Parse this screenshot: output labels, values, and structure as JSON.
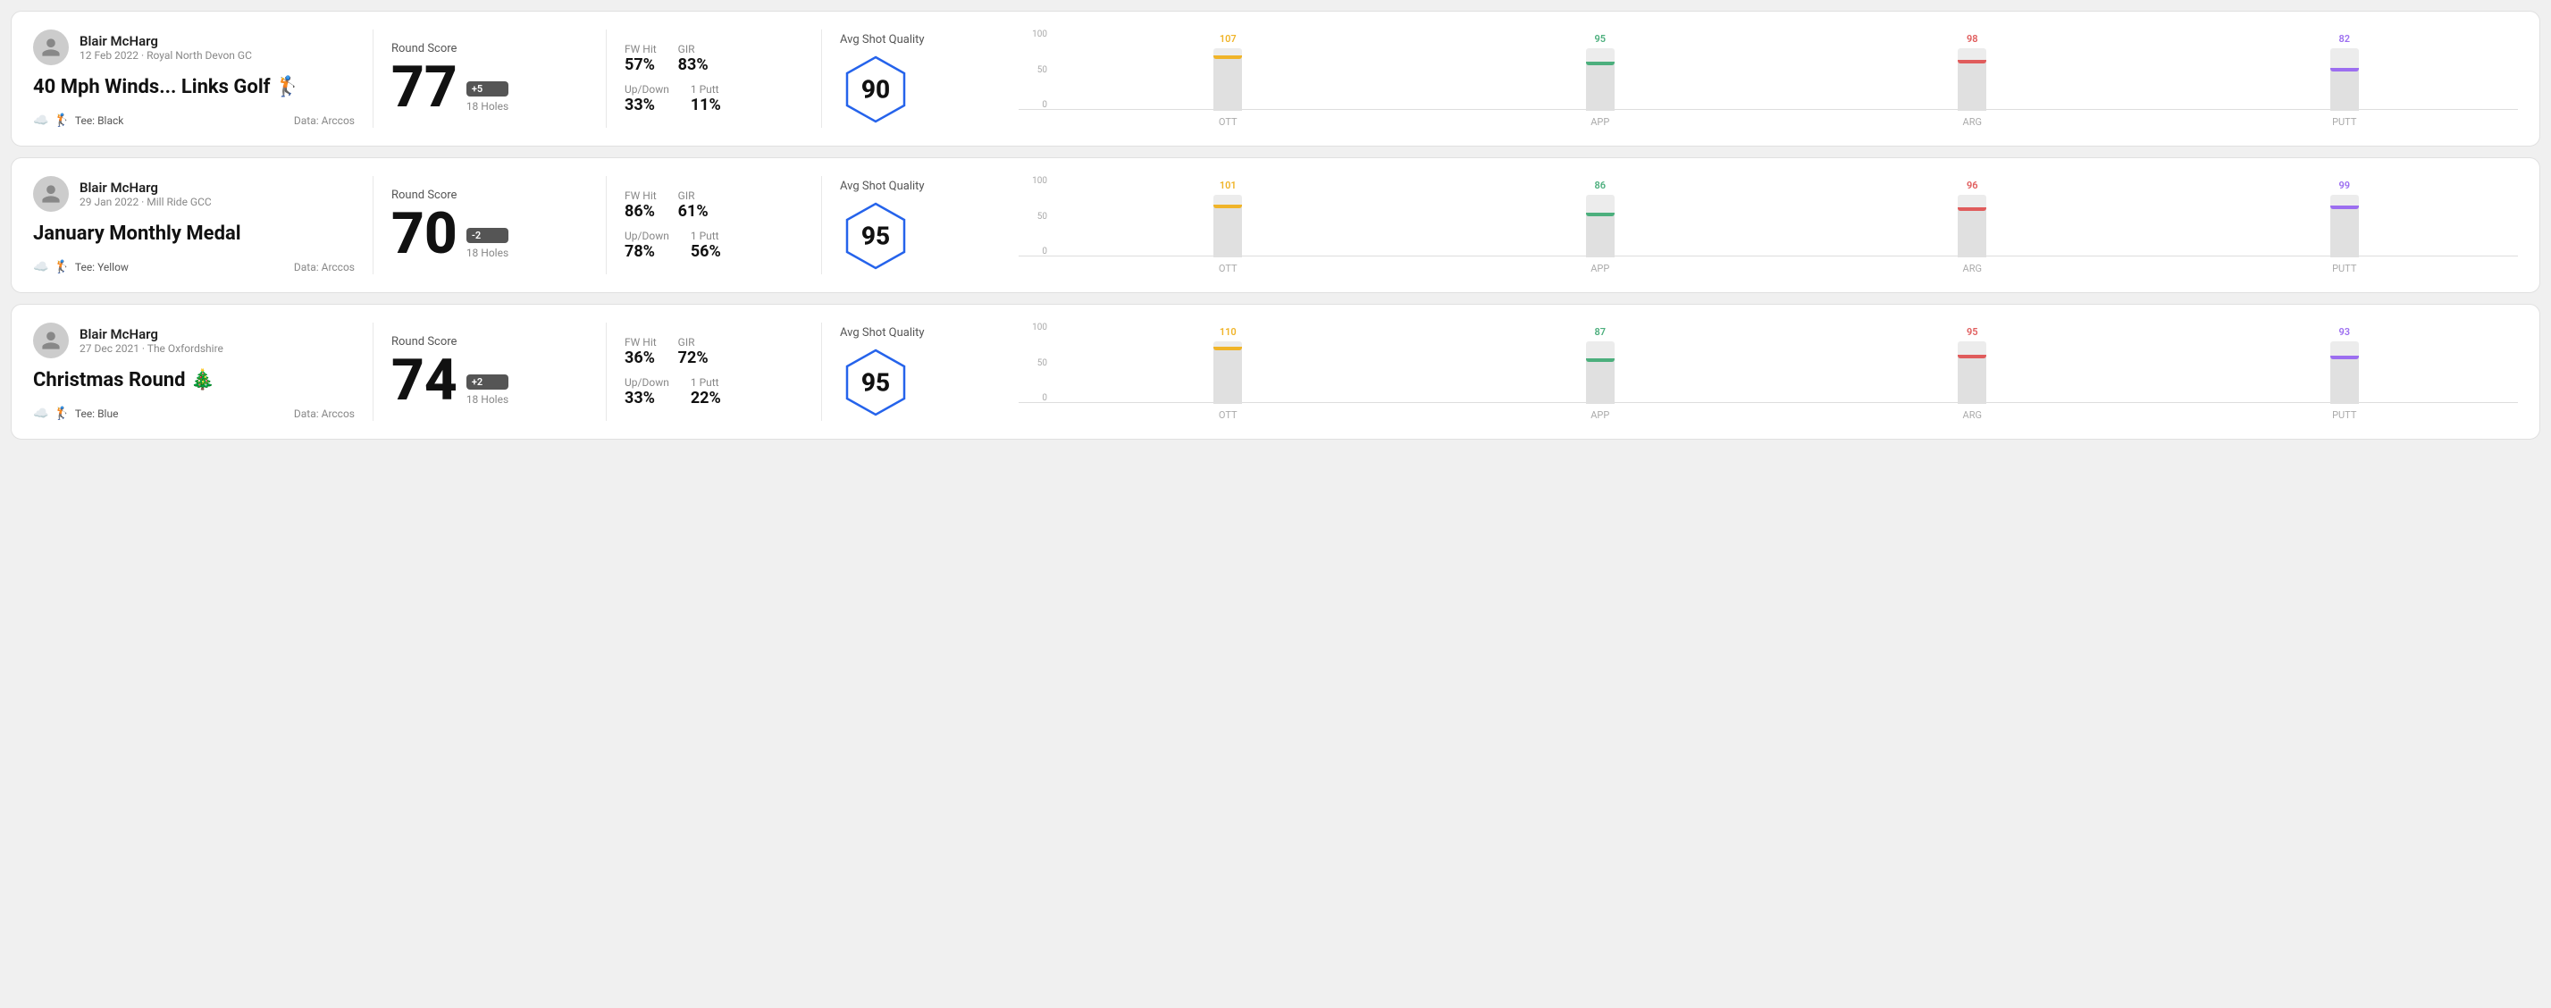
{
  "cards": [
    {
      "id": "card1",
      "user": {
        "name": "Blair McHarg",
        "date": "12 Feb 2022 · Royal North Devon GC"
      },
      "title": "40 Mph Winds... Links Golf 🏌️",
      "tee": "Black",
      "dataSource": "Data: Arccos",
      "score": {
        "label": "Round Score",
        "number": "77",
        "badge": "+5",
        "holes": "18 Holes"
      },
      "stats": {
        "fwHit": "57%",
        "gir": "83%",
        "upDown": "33%",
        "onePutt": "11%"
      },
      "quality": {
        "label": "Avg Shot Quality",
        "score": "90"
      },
      "chart": {
        "bars": [
          {
            "label": "OTT",
            "value": 107,
            "color": "#f0b429",
            "maxH": 70
          },
          {
            "label": "APP",
            "value": 95,
            "color": "#4caf7d",
            "maxH": 70
          },
          {
            "label": "ARG",
            "value": 98,
            "color": "#e05c5c",
            "maxH": 70
          },
          {
            "label": "PUTT",
            "value": 82,
            "color": "#9c6ef0",
            "maxH": 70
          }
        ]
      }
    },
    {
      "id": "card2",
      "user": {
        "name": "Blair McHarg",
        "date": "29 Jan 2022 · Mill Ride GCC"
      },
      "title": "January Monthly Medal",
      "tee": "Yellow",
      "dataSource": "Data: Arccos",
      "score": {
        "label": "Round Score",
        "number": "70",
        "badge": "-2",
        "holes": "18 Holes"
      },
      "stats": {
        "fwHit": "86%",
        "gir": "61%",
        "upDown": "78%",
        "onePutt": "56%"
      },
      "quality": {
        "label": "Avg Shot Quality",
        "score": "95"
      },
      "chart": {
        "bars": [
          {
            "label": "OTT",
            "value": 101,
            "color": "#f0b429",
            "maxH": 70
          },
          {
            "label": "APP",
            "value": 86,
            "color": "#4caf7d",
            "maxH": 70
          },
          {
            "label": "ARG",
            "value": 96,
            "color": "#e05c5c",
            "maxH": 70
          },
          {
            "label": "PUTT",
            "value": 99,
            "color": "#9c6ef0",
            "maxH": 70
          }
        ]
      }
    },
    {
      "id": "card3",
      "user": {
        "name": "Blair McHarg",
        "date": "27 Dec 2021 · The Oxfordshire"
      },
      "title": "Christmas Round 🎄",
      "tee": "Blue",
      "dataSource": "Data: Arccos",
      "score": {
        "label": "Round Score",
        "number": "74",
        "badge": "+2",
        "holes": "18 Holes"
      },
      "stats": {
        "fwHit": "36%",
        "gir": "72%",
        "upDown": "33%",
        "onePutt": "22%"
      },
      "quality": {
        "label": "Avg Shot Quality",
        "score": "95"
      },
      "chart": {
        "bars": [
          {
            "label": "OTT",
            "value": 110,
            "color": "#f0b429",
            "maxH": 70
          },
          {
            "label": "APP",
            "value": 87,
            "color": "#4caf7d",
            "maxH": 70
          },
          {
            "label": "ARG",
            "value": 95,
            "color": "#e05c5c",
            "maxH": 70
          },
          {
            "label": "PUTT",
            "value": 93,
            "color": "#9c6ef0",
            "maxH": 70
          }
        ]
      }
    }
  ],
  "yAxisLabels": [
    "100",
    "50",
    "0"
  ]
}
